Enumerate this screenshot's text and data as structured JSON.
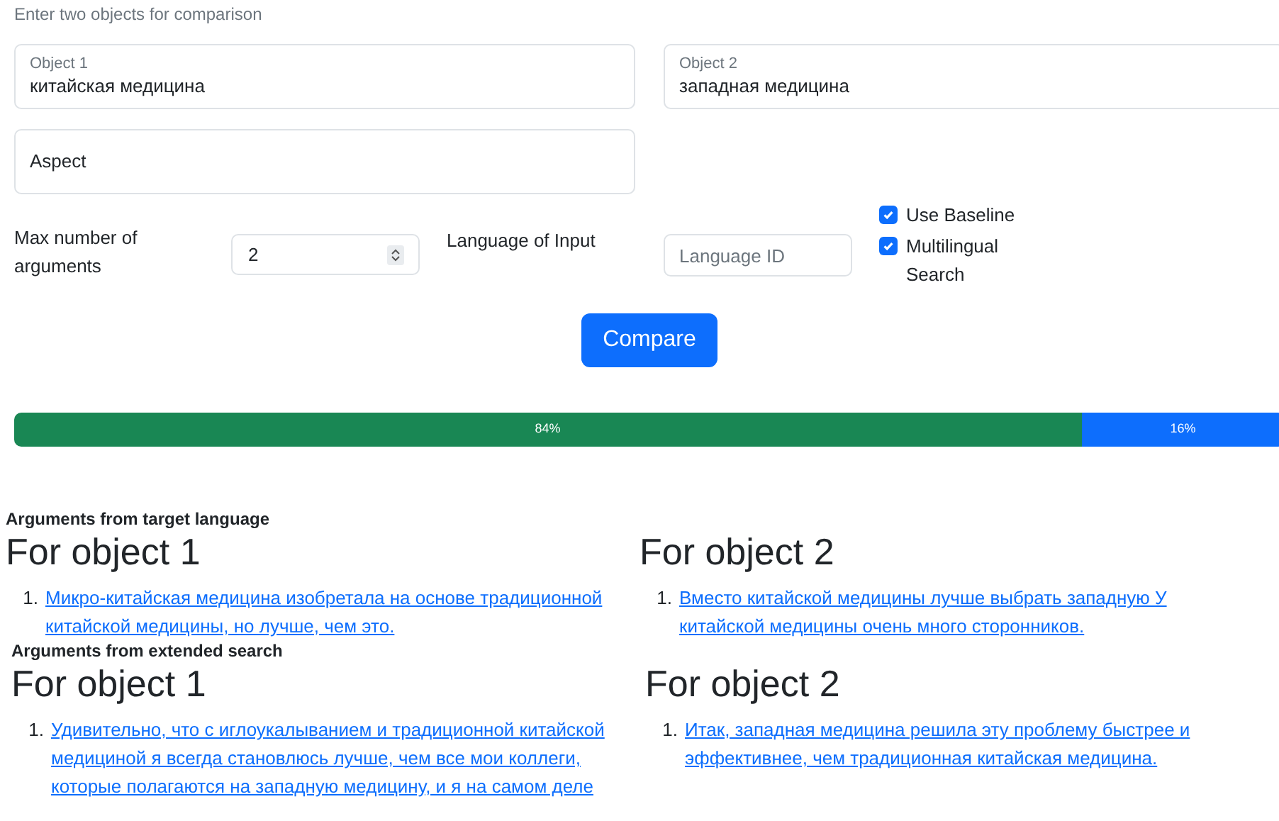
{
  "intro": "Enter two objects for comparison",
  "object_fields": [
    {
      "label": "Object 1",
      "value": "китайская медицина"
    },
    {
      "label": "Object 2",
      "value": "западная медицина"
    }
  ],
  "aspect_field": {
    "placeholder": "Aspect"
  },
  "max_arguments": {
    "label": "Max number of arguments",
    "value": "2"
  },
  "language": {
    "label": "Language of Input",
    "placeholder": "Language ID"
  },
  "options": [
    {
      "label": "Use Baseline",
      "checked": true
    },
    {
      "label": "Multilingual Search",
      "checked": true
    }
  ],
  "compare_button": "Compare",
  "progress": [
    {
      "label": "84%",
      "level": 0.84,
      "color": "#198754"
    },
    {
      "label": "16%",
      "level": 0.16,
      "color": "#0d6efd"
    }
  ],
  "sections": [
    {
      "title": "Arguments from target language",
      "columns": [
        {
          "heading": "For object 1",
          "items": [
            {
              "number": "1.",
              "text": "Микро-китайская медицина изобретала на основе традиционной китайской медицины, но лучше, чем это."
            }
          ]
        },
        {
          "heading": "For object 2",
          "items": [
            {
              "number": "1.",
              "text": "Вместо китайской медицины лучше выбрать западную У китайской медицины очень много сторонников."
            }
          ]
        }
      ]
    },
    {
      "title": "Arguments from extended search",
      "columns": [
        {
          "heading": "For object 1",
          "items": [
            {
              "number": "1.",
              "text": "Удивительно, что с иглоукалыванием и традиционной китайской медициной я всегда становлюсь лучше, чем все мои коллеги, которые полагаются на западную медицину, и я на самом деле"
            }
          ]
        },
        {
          "heading": "For object 2",
          "items": [
            {
              "number": "1.",
              "text": "Итак, западная медицина решила эту проблему быстрее и эффективнее, чем традиционная китайская медицина."
            }
          ]
        }
      ]
    }
  ]
}
